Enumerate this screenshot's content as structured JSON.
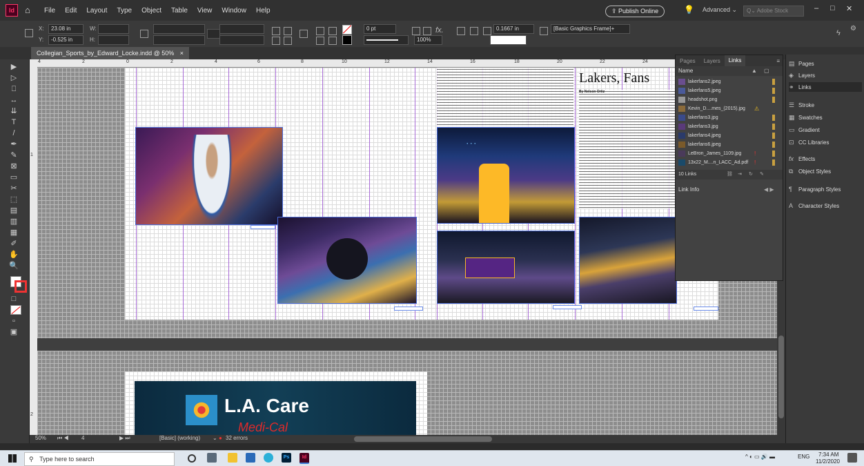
{
  "menubar": {
    "app_icon": "Id",
    "home_icon": "home-icon",
    "items": [
      "File",
      "Edit",
      "Layout",
      "Type",
      "Object",
      "Table",
      "View",
      "Window",
      "Help"
    ],
    "publish": "Publish Online",
    "workspace": "Advanced",
    "stock_placeholder": "Adobe Stock",
    "window_controls": [
      "–",
      "□",
      "✕"
    ]
  },
  "control": {
    "x_label": "X:",
    "x": "23.08 in",
    "y_label": "Y:",
    "y": "-0.525 in",
    "w_label": "W:",
    "h_label": "H:",
    "stroke_weight": "0 pt",
    "zoom": "100%",
    "gap": "0.1667 in",
    "frame_style": "[Basic Graphics Frame]+"
  },
  "tab": {
    "title": "Collegian_Sports_by_Edward_Locke.indd @ 50%",
    "close": "×"
  },
  "ruler": {
    "h_ticks": [
      "4",
      "2",
      "0",
      "2",
      "4",
      "6",
      "8",
      "10",
      "12",
      "14",
      "16",
      "18",
      "20",
      "22",
      "24",
      "26"
    ],
    "v_ticks": [
      "1",
      "2"
    ]
  },
  "spread": {
    "headline": "Lakers, Fans",
    "byline": "By Nelson Ortiz",
    "ad_title": "L.A. Care",
    "ad_sub": "Medi-Cal"
  },
  "status": {
    "zoom": "50%",
    "page": "4",
    "style": "[Basic] (working)",
    "errors": "32 errors"
  },
  "links_panel": {
    "tabs": [
      "Pages",
      "Layers",
      "Links"
    ],
    "name_header": "Name",
    "links": [
      {
        "name": "lakerfans2.jpeg",
        "flag": ""
      },
      {
        "name": "lakerfans5.jpeg",
        "flag": ""
      },
      {
        "name": "headshot.png",
        "flag": ""
      },
      {
        "name": "Kevin_D....mes_(2015).jpg",
        "flag": "⚠"
      },
      {
        "name": "lakerfans3.jpg",
        "flag": ""
      },
      {
        "name": "lakerfans3.jpg",
        "flag": ""
      },
      {
        "name": "lakerfans4.jpeg",
        "flag": ""
      },
      {
        "name": "lakerfans6.jpeg",
        "flag": ""
      },
      {
        "name": "LeBron_James_1109.jpg",
        "flag": "!"
      },
      {
        "name": "13x22_M....n_LACC_Ad.pdf",
        "flag": "!"
      }
    ],
    "count": "10 Links",
    "link_info": "Link Info"
  },
  "dock": {
    "items": [
      {
        "label": "Pages",
        "icon": "pages-icon"
      },
      {
        "label": "Layers",
        "icon": "layers-icon"
      },
      {
        "label": "Links",
        "icon": "links-icon"
      },
      {
        "label": "Stroke",
        "icon": "stroke-icon"
      },
      {
        "label": "Swatches",
        "icon": "swatches-icon"
      },
      {
        "label": "Gradient",
        "icon": "gradient-icon"
      },
      {
        "label": "CC Libraries",
        "icon": "cc-libraries-icon"
      },
      {
        "label": "Effects",
        "icon": "effects-icon"
      },
      {
        "label": "Object Styles",
        "icon": "object-styles-icon"
      },
      {
        "label": "Paragraph Styles",
        "icon": "paragraph-styles-icon"
      },
      {
        "label": "Character Styles",
        "icon": "character-styles-icon"
      }
    ]
  },
  "taskbar": {
    "search_placeholder": "Type here to search",
    "lang": "ENG",
    "time": "7:34 AM",
    "date": "11/2/2020"
  },
  "colors": {
    "accent": "#ff3366",
    "guide": "#a86bd6",
    "frame": "#4a6bd8",
    "lakers_purple": "#552583",
    "lakers_gold": "#fdb927"
  }
}
